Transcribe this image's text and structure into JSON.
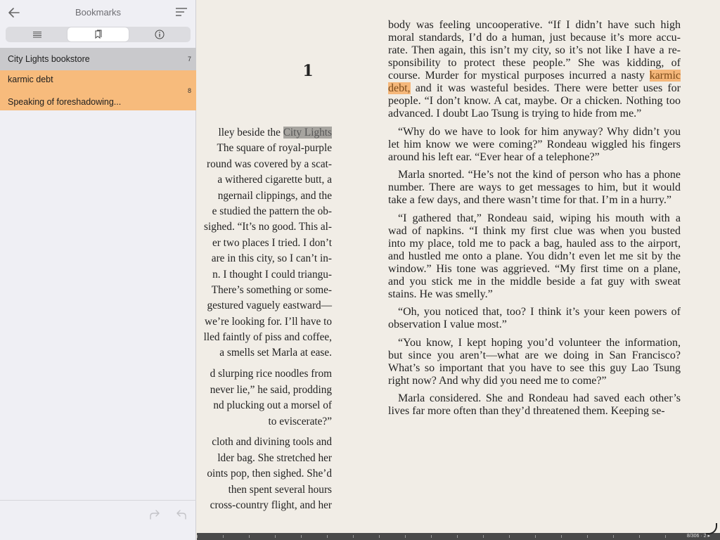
{
  "sidebar": {
    "title": "Bookmarks",
    "tabs": [
      {
        "name": "contents-list-icon"
      },
      {
        "name": "bookmark-icon"
      },
      {
        "name": "info-icon"
      }
    ],
    "bookmarks": [
      {
        "label": "City Lights bookstore",
        "count": "7",
        "color": "#c9c9cc"
      },
      {
        "label": "karmic debt",
        "label2": "Speaking of foreshadowing...",
        "count": "8",
        "color": "#f7bb7c"
      }
    ]
  },
  "reader": {
    "chapter": "1",
    "left_lines": [
      [
        "lley beside the ",
        "City Lights"
      ],
      [
        "The square of royal-purple"
      ],
      [
        "round was covered by a scat-"
      ],
      [
        "a withered cigarette butt, a"
      ],
      [
        "ngernail clippings, and the"
      ],
      [
        "e studied the pattern the ob-"
      ],
      [
        "sighed. “It’s no good. This al-"
      ],
      [
        "er two places I tried. I don’t"
      ],
      [
        "are in this city, so I can’t in-"
      ],
      [
        "n. I thought I could triangu-"
      ],
      [
        "There’s something or some-"
      ],
      [
        "gestured vaguely eastward—"
      ],
      [
        "we’re looking for. I’ll have to"
      ],
      [
        "lled faintly of piss and coffee,"
      ],
      [
        "a smells set Marla at ease."
      ],
      [
        "GAP"
      ],
      [
        "d slurping rice noodles from"
      ],
      [
        "never lie,” he said, prodding"
      ],
      [
        "nd plucking out a morsel of"
      ],
      [
        "to eviscerate?”"
      ],
      [
        "GAP"
      ],
      [
        "cloth and divining tools and"
      ],
      [
        "lder bag. She stretched her"
      ],
      [
        "oints pop, then sighed. She’d"
      ],
      [
        "then spent several hours"
      ],
      [
        "cross-country flight, and her"
      ]
    ],
    "right_paragraphs": [
      {
        "indent": false,
        "lines": [
          "body was feeling uncooperative. “If I didn’t have such high",
          "moral standards, I’d do a human, just because it’s more accu-",
          "rate. Then again, this isn’t my city, so it’s not like I have a re-",
          "sponsibility to protect these people.” She was kidding, of",
          "course. Murder for mystical purposes incurred a nasty karmic",
          "debt, and it was wasteful besides. There were better uses for",
          "people. “I don’t know. A cat, maybe. Or a chicken. Nothing too",
          "advanced. I doubt Lao Tsung is trying to hide from me.”"
        ]
      },
      {
        "indent": true,
        "lines": [
          "“Why do we have to look for him anyway? Why didn’t you",
          "let him know we were coming?” Rondeau wiggled his fingers",
          "around his left ear. “Ever hear of a telephone?”"
        ]
      },
      {
        "indent": true,
        "lines": [
          "Marla snorted. “He’s not the kind of person who has a phone",
          "number. There are ways to get messages to him, but it would",
          "take a few days, and there wasn’t time for that. I’m in a hurry.”"
        ]
      },
      {
        "indent": true,
        "lines": [
          "“I gathered that,” Rondeau said, wiping his mouth with a",
          "wad of napkins. “I think my first clue was when you busted",
          "into my place, told me to pack a bag, hauled ass to the airport,",
          "and hustled me onto a plane. You didn’t even let me sit by the",
          "window.” His tone was aggrieved. “My first time on a plane,",
          "and you stick me in the middle beside a fat guy with sweat",
          "stains. He was smelly.”"
        ]
      },
      {
        "indent": true,
        "lines": [
          "“Oh, you noticed that, too? I think it’s your keen powers of",
          "observation I value most.”"
        ]
      },
      {
        "indent": true,
        "lines": [
          "“You know, I kept hoping you’d volunteer the information,",
          "but since you aren’t—what are we doing in San Francisco?",
          "What’s so important that you have to see this guy Lao Tsung",
          "right now? And why did you need me to come?”"
        ]
      },
      {
        "indent": true,
        "lines": [
          "Marla considered. She and Rondeau had saved each other’s",
          "lives far more often than they’d threatened them. Keeping se-"
        ]
      }
    ],
    "page_indicator": "8/306 · 2 ▸"
  }
}
